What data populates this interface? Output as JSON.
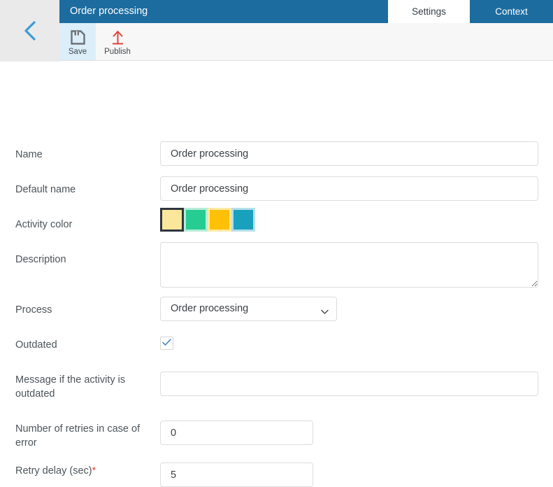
{
  "header": {
    "back_icon": "chevron-left-icon",
    "title": "Order processing",
    "tabs": [
      {
        "label": "Settings",
        "active": true
      },
      {
        "label": "Context",
        "active": false
      }
    ],
    "toolbar": {
      "save": {
        "label": "Save",
        "icon": "floppy-disk-icon"
      },
      "publish": {
        "label": "Publish",
        "icon": "upload-arrow-icon"
      }
    }
  },
  "colors": {
    "brand_blue": "#1d6ca0",
    "back_panel": "#eaeaea",
    "toolbar_bg": "#f7f7f7",
    "save_active_bg": "#dceefa",
    "chevron_blue": "#3d9ad8",
    "publish_red": "#e0443b",
    "required_star": "#e8453c",
    "checkbox_check": "#3f7fc1",
    "swatch_selected_border": "#2f3640"
  },
  "form": {
    "name": {
      "label": "Name",
      "value": "Order processing",
      "placeholder": ""
    },
    "default_name": {
      "label": "Default name",
      "value": "Order processing",
      "placeholder": ""
    },
    "activity_color": {
      "label": "Activity color",
      "options": [
        {
          "name": "cream",
          "fill": "#fbe79b",
          "ring": "#fbe79b",
          "selected": true
        },
        {
          "name": "green",
          "fill": "#27cc92",
          "ring": "#b6ecd8",
          "selected": false
        },
        {
          "name": "amber",
          "fill": "#ffc107",
          "ring": "#ffe9a6",
          "selected": false
        },
        {
          "name": "teal",
          "fill": "#18a0bd",
          "ring": "#b6dfe9",
          "selected": false
        }
      ]
    },
    "description": {
      "label": "Description",
      "value": "",
      "placeholder": ""
    },
    "process": {
      "label": "Process",
      "value": "Order processing",
      "caret_icon": "chevron-down-icon",
      "options": [
        "Order processing"
      ]
    },
    "outdated": {
      "label": "Outdated",
      "checked": true,
      "check_icon": "check-icon"
    },
    "outdated_message": {
      "label": "Message if the activity is outdated",
      "value": "",
      "placeholder": ""
    },
    "retries": {
      "label": "Number of retries in case of error",
      "value": "0",
      "placeholder": ""
    },
    "retry_delay": {
      "label": "Retry delay (sec)",
      "required_marker": "*",
      "value": "5",
      "placeholder": ""
    }
  }
}
